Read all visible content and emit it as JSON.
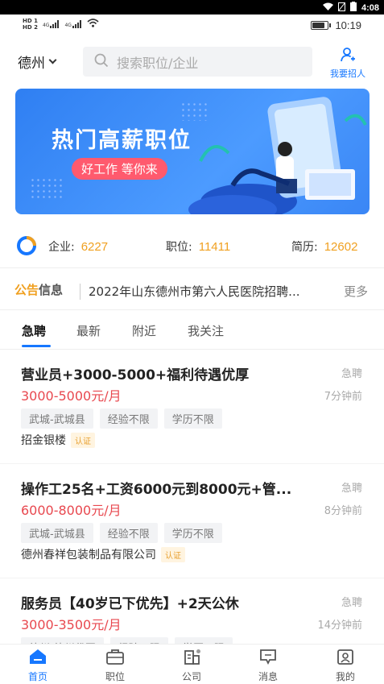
{
  "system_bar": {
    "time": "4:08"
  },
  "status_row": {
    "hd1": "HD 1",
    "hd2": "HD 2",
    "signal1": "4G",
    "signal2": "4G",
    "time": "10:19",
    "battery_level": 0.75
  },
  "header": {
    "city": "德州",
    "search_placeholder": "搜索职位/企业",
    "recruit_label": "我要招人"
  },
  "banner": {
    "title": "热门高薪职位",
    "subtitle": "好工作 等你来"
  },
  "stats": [
    {
      "label": "企业:",
      "value": "6227"
    },
    {
      "label": "职位:",
      "value": "11411"
    },
    {
      "label": "简历:",
      "value": "12602"
    }
  ],
  "notice": {
    "tag_a": "公告",
    "tag_b": "信息",
    "text": "2022年山东德州市第六人民医院招聘...",
    "more": "更多"
  },
  "tabs": [
    "急聘",
    "最新",
    "附近",
    "我关注"
  ],
  "jobs": [
    {
      "title": "营业员+3000-5000+福利待遇优厚",
      "badge": "急聘",
      "salary": "3000-5000元/月",
      "time": "7分钟前",
      "tags": [
        "武城-武城县",
        "经验不限",
        "学历不限"
      ],
      "company": "招金银楼",
      "auth": "认证"
    },
    {
      "title": "操作工25名+工资6000元到8000元+管...",
      "badge": "急聘",
      "salary": "6000-8000元/月",
      "time": "8分钟前",
      "tags": [
        "武城-武城县",
        "经验不限",
        "学历不限"
      ],
      "company": "德州春祥包装制品有限公司",
      "auth": "认证"
    },
    {
      "title": "服务员【40岁已下优先】+2天公休",
      "badge": "急聘",
      "salary": "3000-3500元/月",
      "time": "14分钟前",
      "tags": [
        "德州-德州代区",
        "经验不限",
        "学历不限"
      ],
      "company": "",
      "auth": ""
    }
  ],
  "bottom_nav": [
    {
      "label": "首页",
      "icon": "home-icon"
    },
    {
      "label": "职位",
      "icon": "briefcase-icon"
    },
    {
      "label": "公司",
      "icon": "building-icon"
    },
    {
      "label": "消息",
      "icon": "message-icon"
    },
    {
      "label": "我的",
      "icon": "profile-icon"
    }
  ],
  "colors": {
    "accent": "#1677ff",
    "salary": "#e8484f",
    "stat": "#f0a020"
  }
}
